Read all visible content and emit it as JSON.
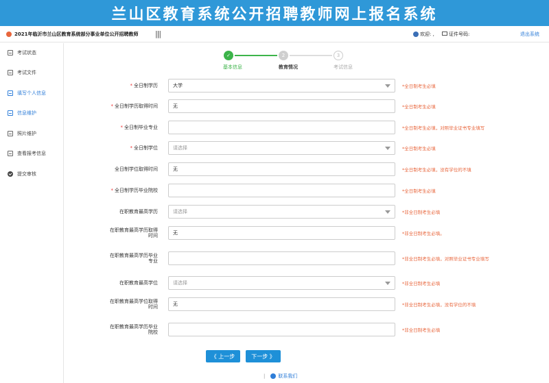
{
  "banner": {
    "title": "兰山区教育系统公开招聘教师网上报名系统"
  },
  "topbar": {
    "exam_title": "2021年临沂市兰山区教育系统部分事业单位公开招聘教师",
    "menu_toggle": "|||",
    "welcome_label": "欢迎: ,",
    "id_label": "证件号码:",
    "logout": "退出系统"
  },
  "sidebar": {
    "items": [
      {
        "label": "考试状态",
        "icon": "document-icon"
      },
      {
        "label": "考试文件",
        "icon": "document-icon"
      },
      {
        "label": "填写个人信息",
        "icon": "edit-icon"
      },
      {
        "label": "信息维护",
        "icon": "edit-icon"
      },
      {
        "label": "照片维护",
        "icon": "image-icon"
      },
      {
        "label": "查看报考信息",
        "icon": "view-icon"
      },
      {
        "label": "提交审核",
        "icon": "check-circle-icon"
      }
    ]
  },
  "steps": {
    "items": [
      {
        "num": "",
        "label": "基本信息"
      },
      {
        "num": "2",
        "label": "教育情况"
      },
      {
        "num": "3",
        "label": "考试信息"
      }
    ]
  },
  "form": {
    "fields": [
      {
        "req": "*",
        "label": "全日制学历",
        "value": "大学",
        "hint": "*全日制考生必填"
      },
      {
        "req": "*",
        "label": "全日制学历取得时间",
        "value": "无",
        "hint": "*全日制考生必填"
      },
      {
        "req": "*",
        "label": "全日制毕业专业",
        "value": "",
        "hint": "*全日制考生必填，对照毕业证书专业填写"
      },
      {
        "req": "*",
        "label": "全日制学位",
        "value": "请选择",
        "hint": "*全日制考生必填"
      },
      {
        "req": "",
        "label": "全日制学位取得时间",
        "value": "无",
        "hint": "*全日制考生必填，没有学位的不填"
      },
      {
        "req": "*",
        "label": "全日制学历毕业院校",
        "value": "",
        "hint": "*全日制考生必填"
      },
      {
        "req": "",
        "label": "在职教育最高学历",
        "value": "请选择",
        "hint": "*非全日制考生必填"
      },
      {
        "req": "",
        "label": "在职教育最高学历取得时间",
        "value": "无",
        "hint": "*非全日制考生必填。"
      },
      {
        "req": "",
        "label": "在职教育最高学历毕业专业",
        "value": "",
        "hint": "*非全日制考生必填，对照毕业证书专业填写"
      },
      {
        "req": "",
        "label": "在职教育最高学位",
        "value": "请选择",
        "hint": "*非全日制考生必填"
      },
      {
        "req": "",
        "label": "在职教育最高学位取得时间",
        "value": "无",
        "hint": "*非全日制考生必填，没有学位的不填"
      },
      {
        "req": "",
        "label": "在职教育最高学历毕业院校",
        "value": "",
        "hint": "*非全日制考生必填"
      }
    ]
  },
  "buttons": {
    "prev": "《 上一步",
    "next": "下一步 》"
  },
  "footer": {
    "separator": "|",
    "contact": "联系我们"
  }
}
